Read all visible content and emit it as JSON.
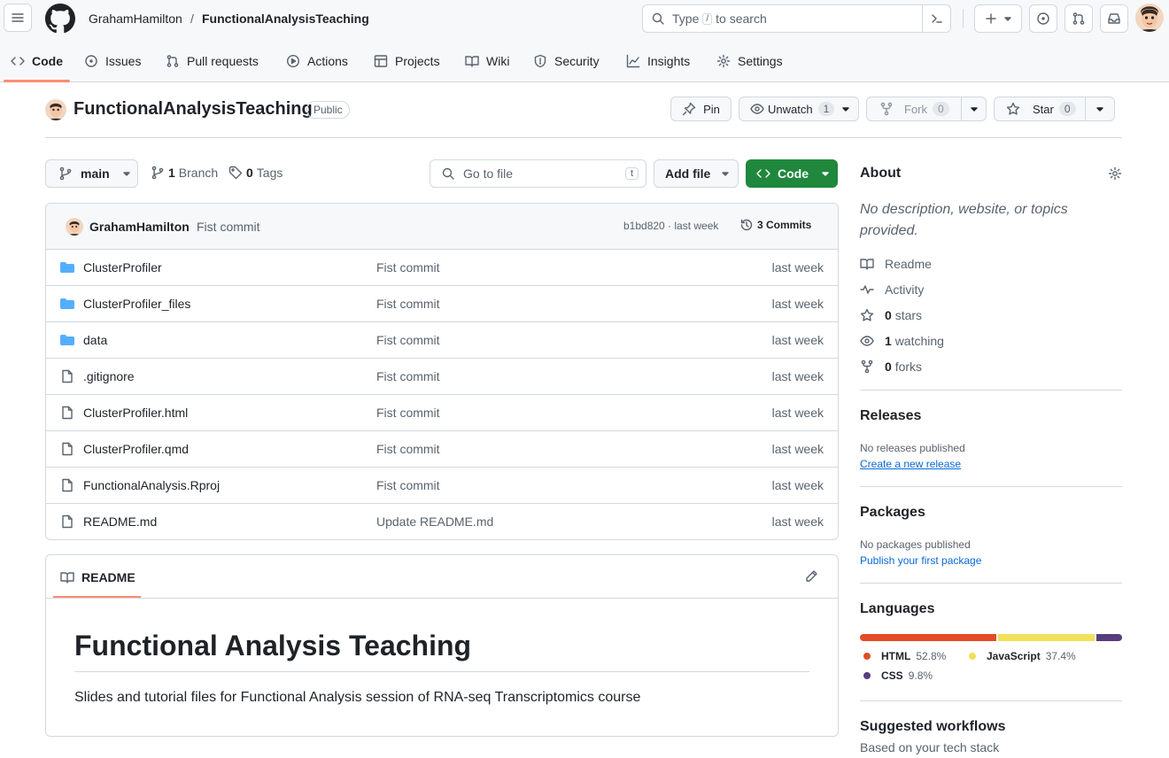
{
  "header": {
    "owner": "GrahamHamilton",
    "separator": "/",
    "repo": "FunctionalAnalysisTeaching",
    "search_prefix": "Type",
    "search_key": "/",
    "search_suffix": "to search"
  },
  "tabs": [
    "Code",
    "Issues",
    "Pull requests",
    "Actions",
    "Projects",
    "Wiki",
    "Security",
    "Insights",
    "Settings"
  ],
  "repo": {
    "name": "FunctionalAnalysisTeaching",
    "visibility": "Public",
    "pin_label": "Pin",
    "unwatch_label": "Unwatch",
    "watch_count": "1",
    "fork_label": "Fork",
    "fork_count": "0",
    "star_label": "Star",
    "star_count": "0"
  },
  "toolbar": {
    "branch": "main",
    "branch_count": "1",
    "branch_label": "Branch",
    "tag_count": "0",
    "tag_label": "Tags",
    "goto_placeholder": "Go to file",
    "goto_key": "t",
    "add_file_label": "Add file",
    "code_label": "Code"
  },
  "commit": {
    "author": "GrahamHamilton",
    "message": "Fist commit",
    "hash_time": "b1bd820 · last week",
    "commits_label": "3 Commits"
  },
  "files": [
    {
      "name": "ClusterProfiler",
      "type": "folder",
      "message": "Fist commit",
      "date": "last week"
    },
    {
      "name": "ClusterProfiler_files",
      "type": "folder",
      "message": "Fist commit",
      "date": "last week"
    },
    {
      "name": "data",
      "type": "folder",
      "message": "Fist commit",
      "date": "last week"
    },
    {
      "name": ".gitignore",
      "type": "file",
      "message": "Fist commit",
      "date": "last week"
    },
    {
      "name": "ClusterProfiler.html",
      "type": "file",
      "message": "Fist commit",
      "date": "last week"
    },
    {
      "name": "ClusterProfiler.qmd",
      "type": "file",
      "message": "Fist commit",
      "date": "last week"
    },
    {
      "name": "FunctionalAnalysis.Rproj",
      "type": "file",
      "message": "Fist commit",
      "date": "last week"
    },
    {
      "name": "README.md",
      "type": "file",
      "message": "Update README.md",
      "date": "last week"
    }
  ],
  "readme": {
    "tab_label": "README",
    "heading": "Functional Analysis Teaching",
    "body": "Slides and tutorial files for Functional Analysis session of RNA-seq Transcriptomics course"
  },
  "about": {
    "title": "About",
    "description": "No description, website, or topics provided.",
    "readme": "Readme",
    "activity": "Activity",
    "stars_count": "0",
    "stars_label": "stars",
    "watching_count": "1",
    "watching_label": "watching",
    "forks_count": "0",
    "forks_label": "forks"
  },
  "releases": {
    "title": "Releases",
    "none": "No releases published",
    "link": "Create a new release"
  },
  "packages": {
    "title": "Packages",
    "none": "No packages published",
    "link": "Publish your first package"
  },
  "languages": {
    "title": "Languages",
    "items": [
      {
        "name": "HTML",
        "percent": "52.8%",
        "value": 52.8,
        "color": "#e34c26"
      },
      {
        "name": "JavaScript",
        "percent": "37.4%",
        "value": 37.4,
        "color": "#f1e05a"
      },
      {
        "name": "CSS",
        "percent": "9.8%",
        "value": 9.8,
        "color": "#563d7c"
      }
    ]
  },
  "workflows": {
    "title": "Suggested workflows",
    "subtitle": "Based on your tech stack"
  },
  "colors": {
    "accent_green": "#1f883d",
    "link_blue": "#0969da",
    "folder_blue": "#54aeff",
    "tab_underline": "#fd8c73"
  }
}
